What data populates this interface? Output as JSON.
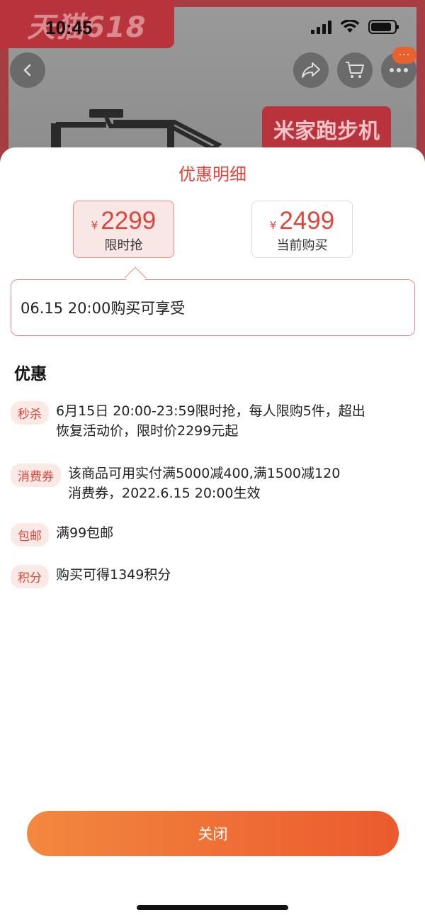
{
  "status_bar": {
    "time": "10:45"
  },
  "background": {
    "logo_text": "天猫618",
    "promo_tag": "米家跑步机",
    "more_badge": "···"
  },
  "sheet": {
    "title": "优惠明细",
    "price_options": [
      {
        "currency": "¥",
        "price": "2299",
        "label": "限时抢",
        "selected": true
      },
      {
        "currency": "¥",
        "price": "2499",
        "label": "当前购买",
        "selected": false
      }
    ],
    "info": "06.15 20:00购买可享受",
    "section_title": "优惠",
    "perks": [
      {
        "tag": "秒杀",
        "text": "6月15日 20:00-23:59限时抢，每人限购5件，超出恢复活动价，限时价2299元起"
      },
      {
        "tag": "消费券",
        "text": "该商品可用实付满5000减400,满1500减120消费券，2022.6.15 20:00生效"
      },
      {
        "tag": "包邮",
        "text": "满99包邮"
      },
      {
        "tag": "积分",
        "text": "购买可得1349积分"
      }
    ],
    "close_label": "关闭"
  },
  "colors": {
    "accent": "#e0443b",
    "button_start": "#f28840",
    "button_end": "#ec5a2d"
  }
}
